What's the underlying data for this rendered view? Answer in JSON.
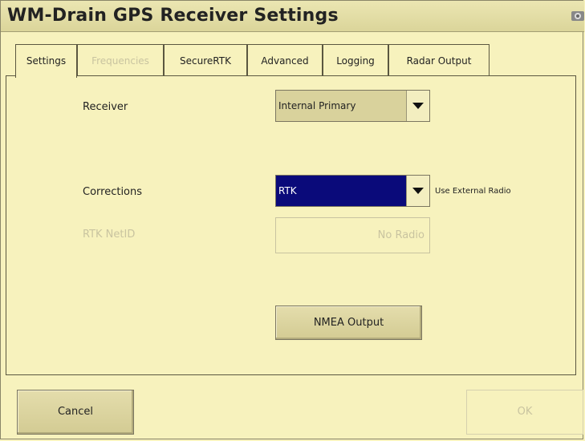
{
  "window": {
    "title": "WM-Drain GPS Receiver Settings"
  },
  "tabs": [
    {
      "label": "Settings",
      "state": "active"
    },
    {
      "label": "Frequencies",
      "state": "disabled"
    },
    {
      "label": "SecureRTK",
      "state": "normal"
    },
    {
      "label": "Advanced",
      "state": "normal"
    },
    {
      "label": "Logging",
      "state": "normal"
    },
    {
      "label": "Radar Output",
      "state": "normal"
    }
  ],
  "settings": {
    "receiver_label": "Receiver",
    "receiver_value": "Internal Primary",
    "corrections_label": "Corrections",
    "corrections_value": "RTK",
    "external_radio_label": "Use External Radio",
    "netid_label": "RTK NetID",
    "netid_value": "No Radio",
    "nmea_button": "NMEA Output"
  },
  "footer": {
    "cancel": "Cancel",
    "ok": "OK"
  },
  "colors": {
    "background": "#f7f2bd",
    "selected": "#0a0a7a"
  }
}
